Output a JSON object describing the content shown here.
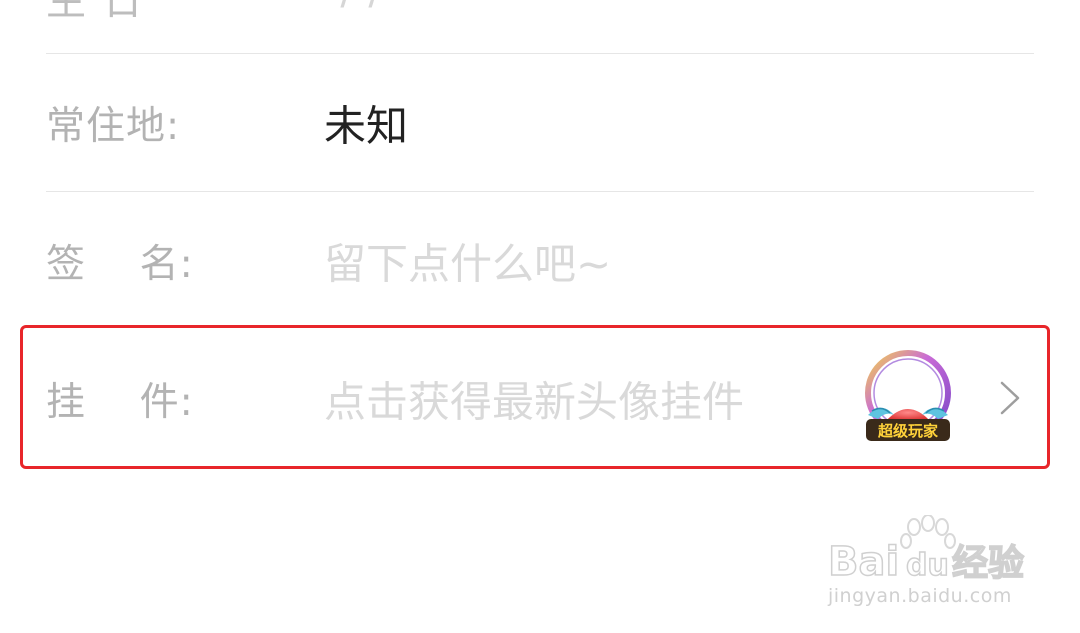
{
  "top_row": {
    "label": "生 日",
    "value": "-/-/-"
  },
  "rows": [
    {
      "label": "常住地:",
      "value": "未知",
      "value_style": "dark"
    },
    {
      "label": "签    名:",
      "value": "留下点什么吧~",
      "value_style": "placeholder"
    },
    {
      "label": "挂    件:",
      "value": "点击获得最新头像挂件",
      "value_style": "placeholder"
    }
  ],
  "pendant": {
    "badge_text": "超级玩家",
    "icon": "avatar-pendant-icon"
  },
  "chevron_icon": "chevron-right-icon",
  "highlight_color": "#e8262a",
  "watermark": {
    "logo_text_a": "Bai",
    "logo_text_b": "du",
    "logo_text_c": "经验",
    "url": "jingyan.baidu.com"
  }
}
